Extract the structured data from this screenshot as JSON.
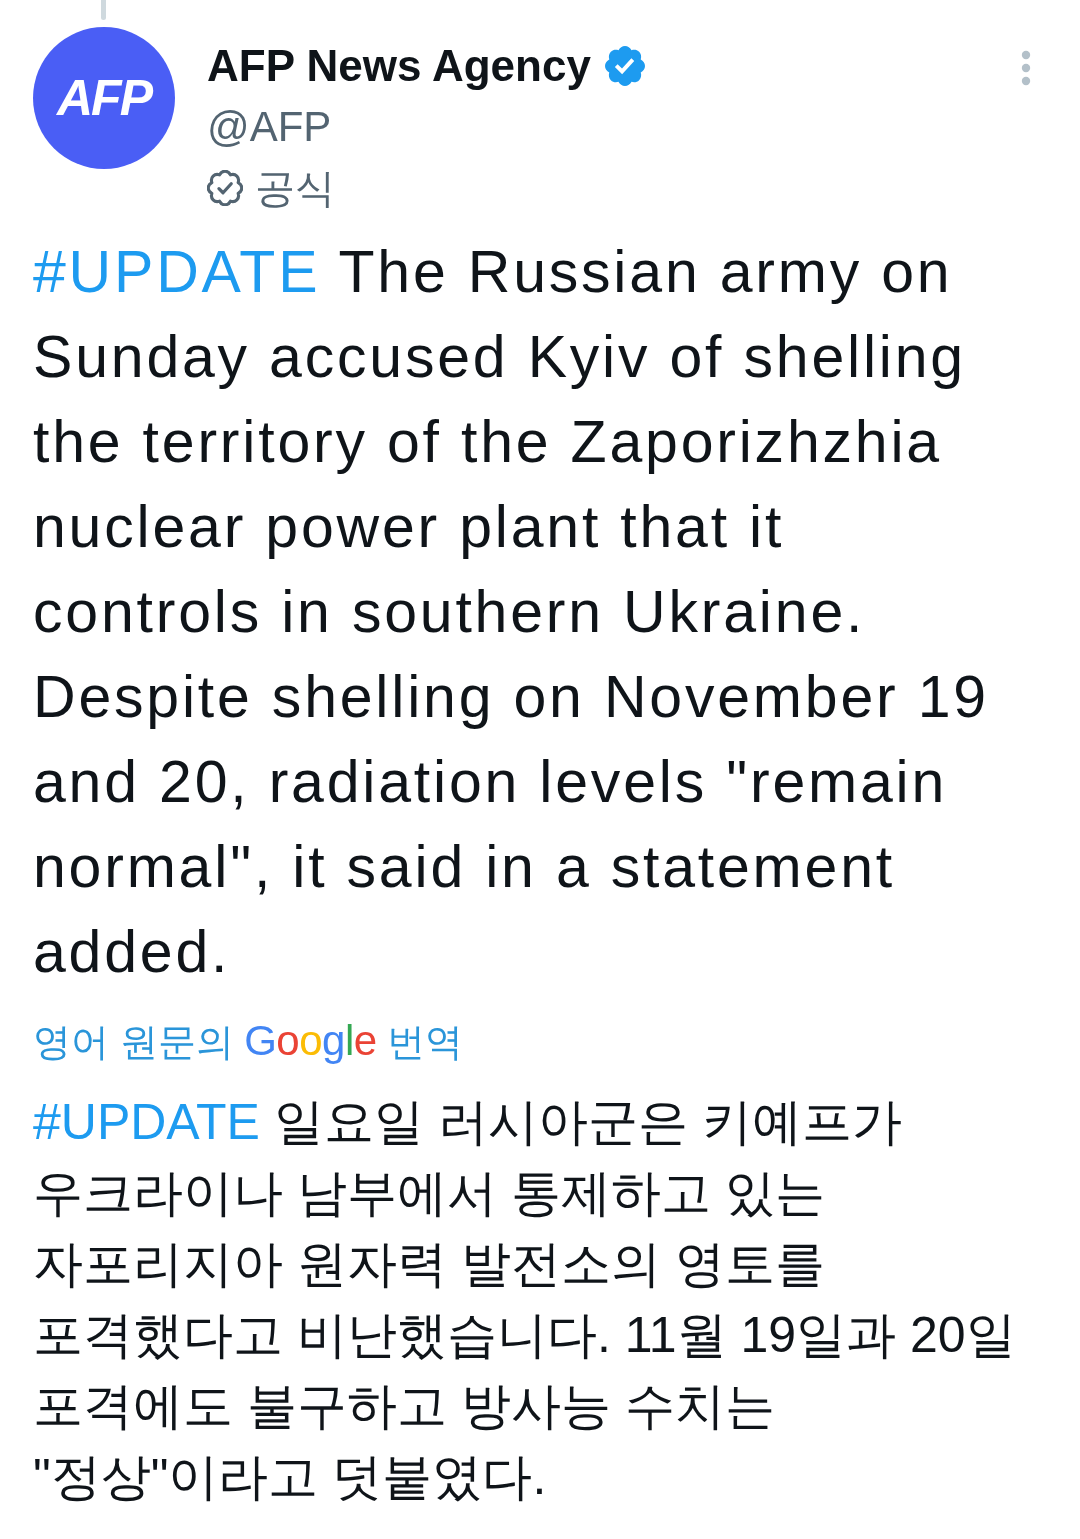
{
  "author": {
    "avatar_text": "AFP",
    "name": "AFP News Agency",
    "verified": true,
    "handle": "@AFP",
    "label": "공식"
  },
  "tweet": {
    "hashtag": "#UPDATE",
    "text": "The Russian army on Sunday accused Kyiv of shelling the territory of the Zaporizhzhia nuclear power plant that it controls in southern Ukraine. Despite shelling on November 19 and 20, radiation levels \"remain normal\", it said in a statement added."
  },
  "translation": {
    "prefix": "영어 원문의",
    "brand": "Google",
    "suffix": "번역",
    "hashtag": "#UPDATE",
    "text": "일요일 러시아군은 키예프가 우크라이나 남부에서 통제하고 있는 자포리지아 원자력 발전소의 영토를 포격했다고 비난했습니다. 11월 19일과 20일 포격에도 불구하고 방사능 수치는 \"정상\"이라고 덧붙였다."
  }
}
